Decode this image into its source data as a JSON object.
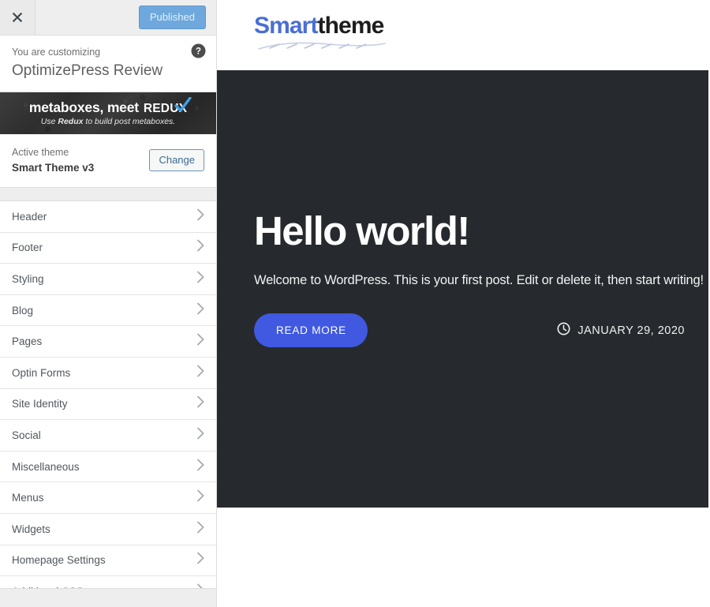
{
  "customizer": {
    "close_icon": "close-icon",
    "publish_label": "Published",
    "eyebrow": "You are customizing",
    "site_name": "OptimizePress Review",
    "help_icon": "help-icon",
    "banner": {
      "line1_part1": "metaboxes, meet",
      "line1_part2": "REDUX",
      "line2_prefix": "Use ",
      "line2_strong": "Redux",
      "line2_suffix": " to build post metaboxes.",
      "check_icon": "check-icon"
    },
    "theme": {
      "label": "Active theme",
      "name": "Smart Theme v3",
      "change_label": "Change"
    },
    "nav_items": [
      {
        "label": "Header",
        "chevron": "chevron-right-icon"
      },
      {
        "label": "Footer",
        "chevron": "chevron-right-icon"
      },
      {
        "label": "Styling",
        "chevron": "chevron-right-icon"
      },
      {
        "label": "Blog",
        "chevron": "chevron-right-icon"
      },
      {
        "label": "Pages",
        "chevron": "chevron-right-icon"
      },
      {
        "label": "Optin Forms",
        "chevron": "chevron-right-icon"
      },
      {
        "label": "Site Identity",
        "chevron": "chevron-right-icon"
      },
      {
        "label": "Social",
        "chevron": "chevron-right-icon"
      },
      {
        "label": "Miscellaneous",
        "chevron": "chevron-right-icon"
      },
      {
        "label": "Menus",
        "chevron": "chevron-right-icon"
      },
      {
        "label": "Widgets",
        "chevron": "chevron-right-icon"
      },
      {
        "label": "Homepage Settings",
        "chevron": "chevron-right-icon"
      },
      {
        "label": "Additional CSS",
        "chevron": "chevron-right-icon"
      }
    ]
  },
  "preview": {
    "logo": {
      "part1": "Smart",
      "part2": "theme"
    },
    "hero": {
      "title": "Hello world!",
      "subtitle": "Welcome to WordPress. This is your first post. Edit or delete it, then start writing!",
      "read_more_label": "READ MORE",
      "date": "JANUARY 29, 2020",
      "clock_icon": "clock-icon"
    }
  },
  "colors": {
    "publish_blue": "#6fa8dc",
    "change_border": "#6b93b8",
    "hero_bg": "#262a2e",
    "read_more_blue": "#4059e0",
    "logo_blue": "#4a6fd4",
    "sidebar_border": "#dddddd"
  }
}
